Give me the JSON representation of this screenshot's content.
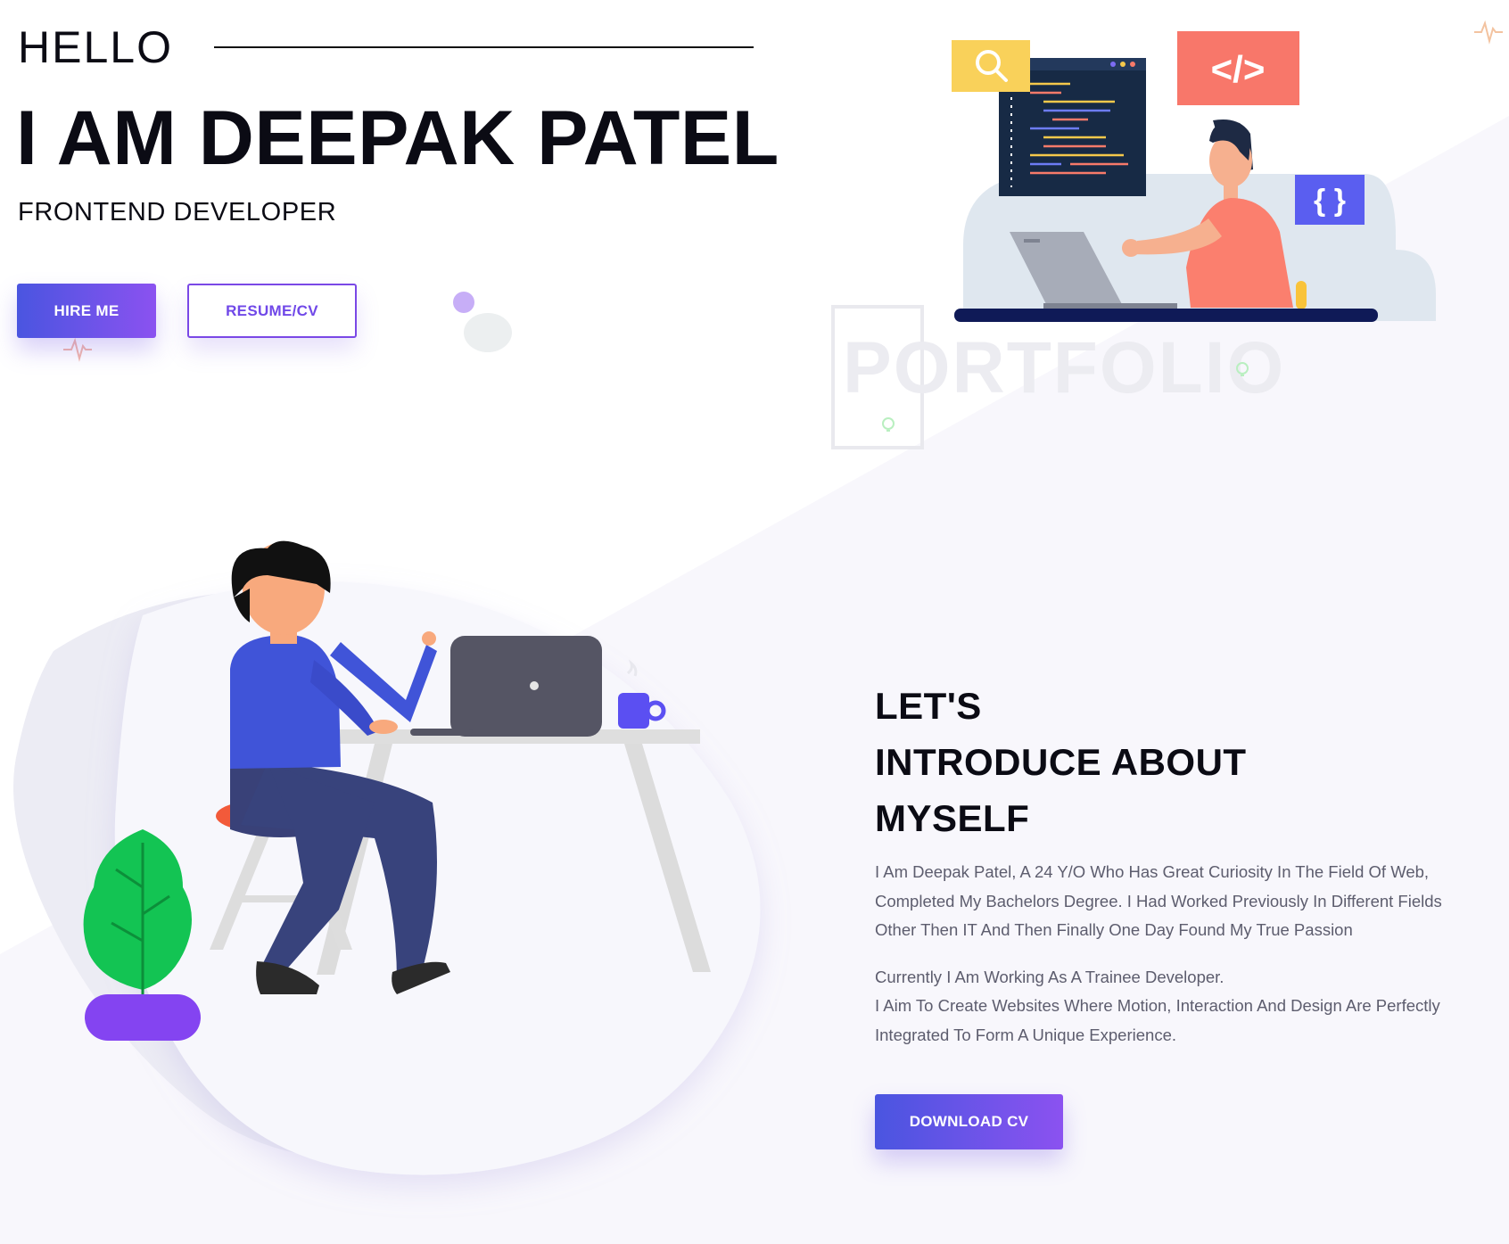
{
  "hero": {
    "greeting": "HELLO",
    "name": "I AM DEEPAK PATEL",
    "role": "FRONTEND DEVELOPER",
    "hire_label": "HIRE ME",
    "resume_label": "RESUME/CV",
    "watermark": "PORTFOLIO",
    "illustration": {
      "code_tag": "</>",
      "braces": "{ }"
    }
  },
  "about": {
    "title_lines": [
      "LET'S",
      "INTRODUCE ABOUT",
      "MYSELF"
    ],
    "paragraph_1": "I Am Deepak Patel, A 24 Y/O Who Has Great Curiosity In The Field Of Web, Completed My Bachelors Degree. I Had Worked Previously In Different Fields Other Then IT And Then Finally One Day Found My True Passion",
    "paragraph_2_line_1": "Currently I Am Working As A Trainee Developer.",
    "paragraph_2_line_2": "I Aim To Create Websites Where Motion, Interaction And Design Are Perfectly Integrated To Form A Unique Experience.",
    "download_label": "DOWNLOAD CV"
  },
  "icons": [
    "search-icon",
    "code-icon",
    "braces-icon",
    "lightbulb-icon",
    "pulse-icon"
  ],
  "colors": {
    "accent_start": "#4a55e0",
    "accent_end": "#8b52f0",
    "text_dark": "#0b0b14",
    "text_muted": "#5d5d6e",
    "tint_background": "#f8f7fc"
  }
}
